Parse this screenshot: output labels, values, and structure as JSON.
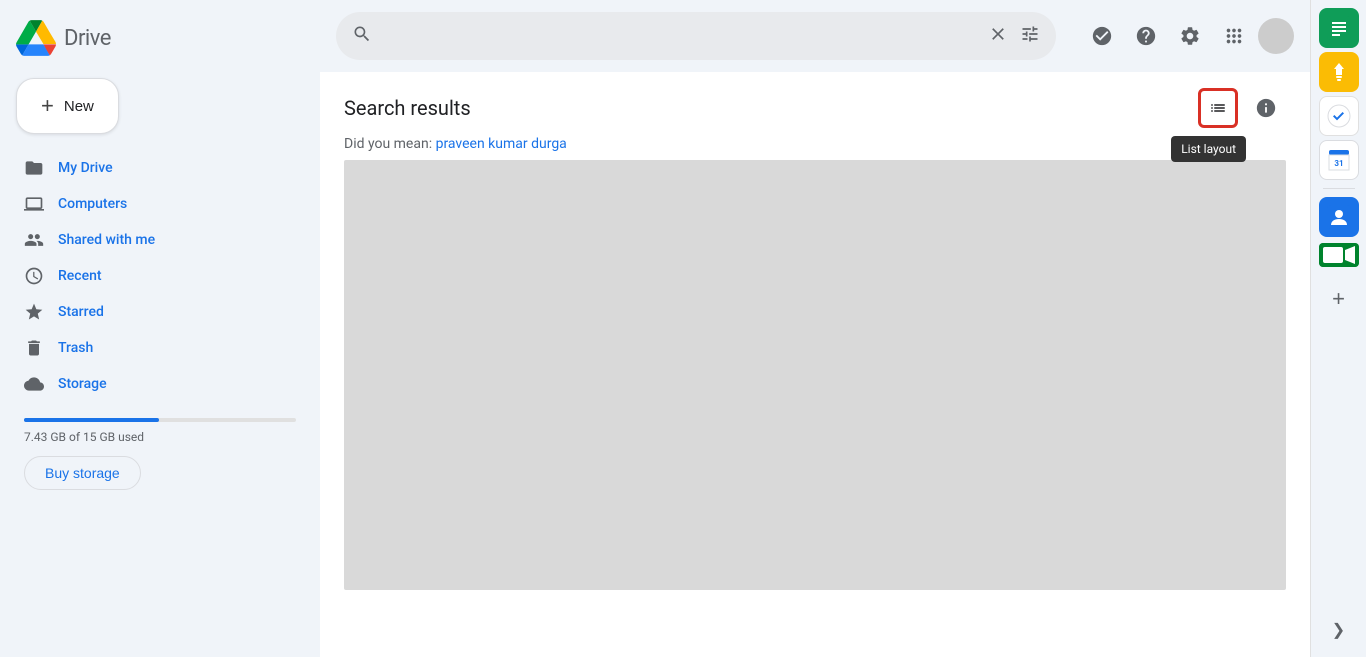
{
  "app": {
    "title": "Drive"
  },
  "new_button": {
    "label": "New",
    "plus_symbol": "+"
  },
  "sidebar": {
    "items": [
      {
        "id": "my-drive",
        "label": "My Drive",
        "icon": "folder"
      },
      {
        "id": "computers",
        "label": "Computers",
        "icon": "computer"
      },
      {
        "id": "shared-with-me",
        "label": "Shared with me",
        "icon": "people"
      },
      {
        "id": "recent",
        "label": "Recent",
        "icon": "clock"
      },
      {
        "id": "starred",
        "label": "Starred",
        "icon": "star"
      },
      {
        "id": "trash",
        "label": "Trash",
        "icon": "trash"
      },
      {
        "id": "storage",
        "label": "Storage",
        "icon": "cloud"
      }
    ],
    "storage": {
      "used_text": "7.43 GB of 15 GB used",
      "used_percent": 49.5,
      "buy_label": "Buy storage"
    }
  },
  "search": {
    "placeholder": "",
    "value": "",
    "clear_label": "×",
    "filter_label": "⊟"
  },
  "topbar": {
    "status_check_icon": "✓",
    "help_icon": "?",
    "settings_icon": "⚙",
    "apps_icon": "⋮⋮⋮"
  },
  "main": {
    "page_title": "Search results",
    "did_you_mean_prefix": "Did you mean: ",
    "did_you_mean_link": "praveen kumar durga",
    "list_layout_tooltip": "List layout",
    "list_layout_icon": "☰",
    "info_icon": "ⓘ"
  },
  "right_panel": {
    "icons": [
      {
        "id": "sheets",
        "label": "Google Sheets",
        "type": "sheets",
        "symbol": "S"
      },
      {
        "id": "keep",
        "label": "Google Keep",
        "type": "keep",
        "symbol": "💡"
      },
      {
        "id": "tasks",
        "label": "Google Tasks",
        "type": "tasks",
        "symbol": "✔"
      },
      {
        "id": "calendar",
        "label": "Google Calendar",
        "type": "calendar",
        "symbol": "📅"
      },
      {
        "id": "contacts",
        "label": "Google Contacts",
        "type": "contacts",
        "symbol": "👤"
      },
      {
        "id": "meet",
        "label": "Google Meet",
        "type": "meet",
        "symbol": "▶"
      }
    ],
    "add_label": "+",
    "collapse_label": "❯"
  }
}
